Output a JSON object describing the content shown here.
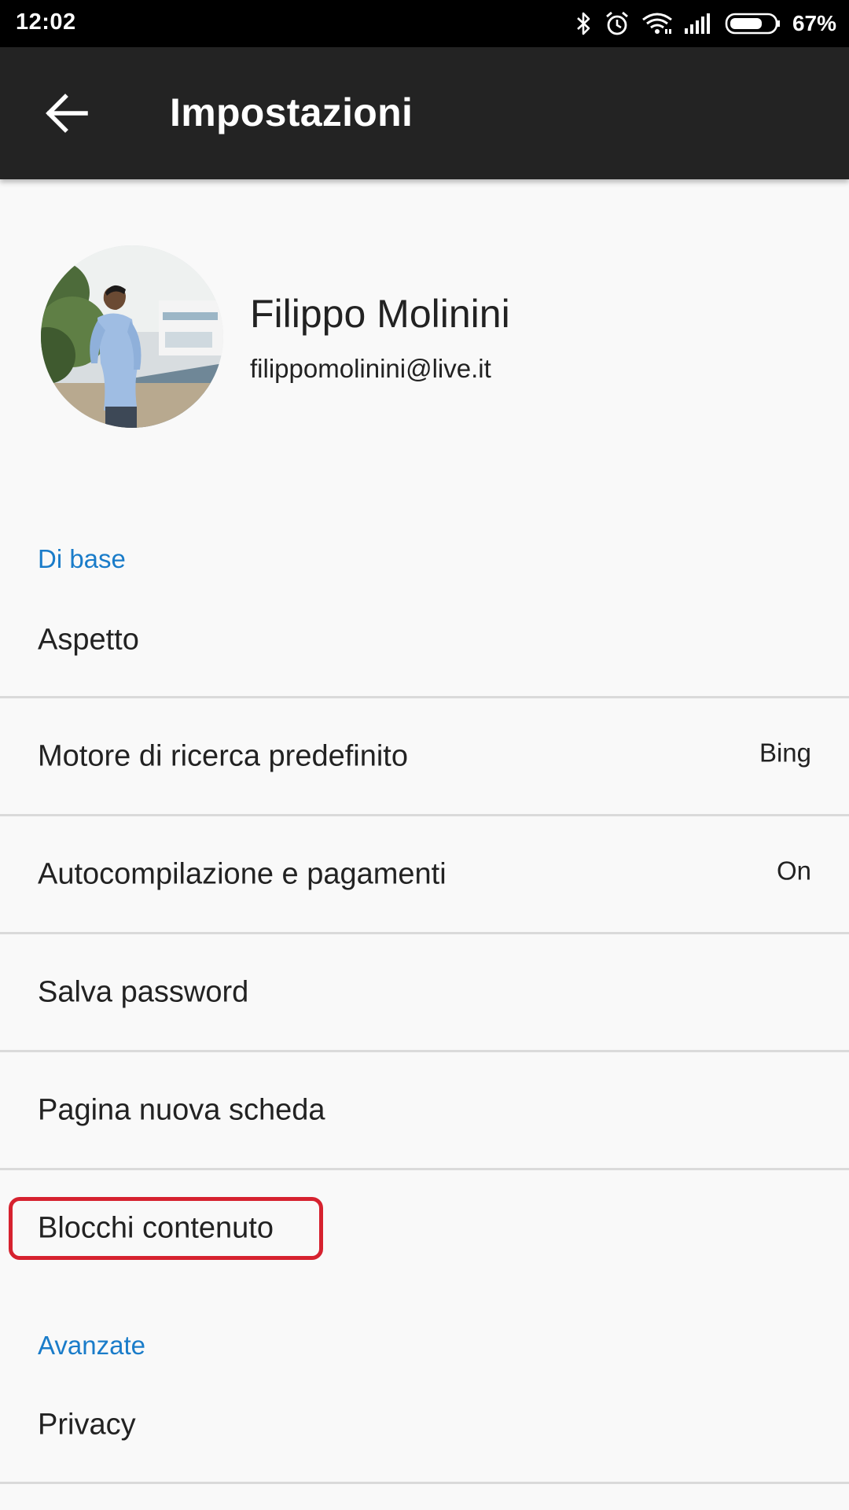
{
  "status_bar": {
    "time": "12:02",
    "battery_percent": "67%",
    "icons": [
      "bluetooth-icon",
      "alarm-icon",
      "wifi-icon",
      "signal-icon",
      "battery-icon"
    ]
  },
  "app_bar": {
    "title": "Impostazioni",
    "back_icon": "arrow-left-icon"
  },
  "profile": {
    "name": "Filippo Molinini",
    "email": "filippomolinini@live.it"
  },
  "sections": {
    "basic": {
      "header": "Di base",
      "items": [
        {
          "label": "Aspetto",
          "value": ""
        },
        {
          "label": "Motore di ricerca predefinito",
          "value": "Bing"
        },
        {
          "label": "Autocompilazione e pagamenti",
          "value": "On"
        },
        {
          "label": "Salva password",
          "value": ""
        },
        {
          "label": "Pagina nuova scheda",
          "value": ""
        },
        {
          "label": "Blocchi contenuto",
          "value": ""
        }
      ]
    },
    "advanced": {
      "header": "Avanzate",
      "items": [
        {
          "label": "Privacy",
          "value": ""
        }
      ]
    }
  },
  "colors": {
    "accent": "#1a7cc9",
    "app_bar": "#232323",
    "highlight": "#d6222f",
    "background": "#f9f9f9"
  }
}
